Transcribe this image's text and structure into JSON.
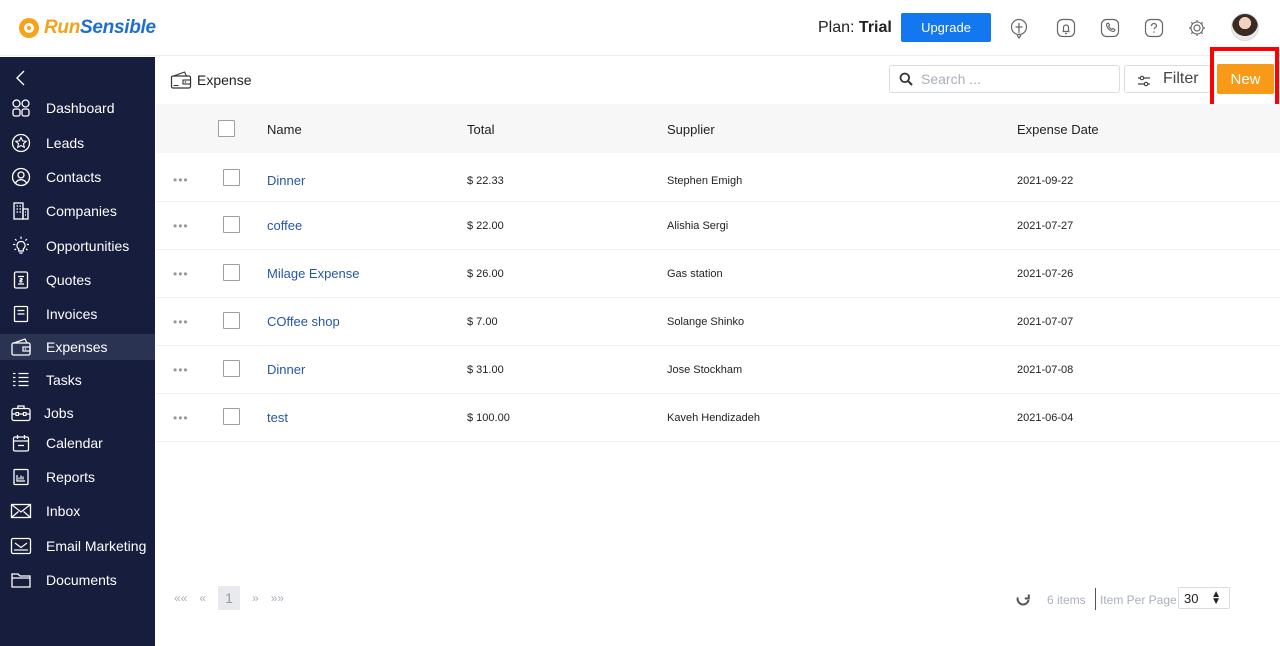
{
  "app": {
    "logo_part1": "Run",
    "logo_part2": "Sensible",
    "plan_label": "Plan:",
    "plan_value": "Trial",
    "upgrade_label": "Upgrade",
    "colors": {
      "accent_orange": "#f89a17",
      "primary_blue": "#1377ef",
      "sidebar_bg": "#161d3d",
      "link_blue": "#2656a6",
      "highlight_red": "#ff0000"
    }
  },
  "sidebar": {
    "items": [
      {
        "label": "Dashboard",
        "icon": "dashboard-icon"
      },
      {
        "label": "Leads",
        "icon": "star-badge-icon"
      },
      {
        "label": "Contacts",
        "icon": "contact-icon"
      },
      {
        "label": "Companies",
        "icon": "building-icon"
      },
      {
        "label": "Opportunities",
        "icon": "lightbulb-icon"
      },
      {
        "label": "Quotes",
        "icon": "quote-document-icon"
      },
      {
        "label": "Invoices",
        "icon": "invoice-icon"
      },
      {
        "label": "Expenses",
        "icon": "wallet-icon"
      },
      {
        "label": "Tasks",
        "icon": "task-list-icon"
      },
      {
        "label": "Jobs",
        "icon": "toolbox-icon"
      },
      {
        "label": "Calendar",
        "icon": "calendar-icon"
      },
      {
        "label": "Reports",
        "icon": "report-chart-icon"
      },
      {
        "label": "Inbox",
        "icon": "envelope-icon"
      },
      {
        "label": "Email Marketing",
        "icon": "email-marketing-icon"
      },
      {
        "label": "Documents",
        "icon": "folder-icon"
      }
    ],
    "active": "Expenses"
  },
  "page": {
    "title": "Expense",
    "search_placeholder": "Search ...",
    "filter_label": "Filter",
    "new_label": "New"
  },
  "table": {
    "columns": [
      "Name",
      "Total",
      "Supplier",
      "Expense Date"
    ],
    "rows": [
      {
        "name": "Dinner",
        "total": "$ 22.33",
        "supplier": "Stephen Emigh",
        "date": "2021-09-22"
      },
      {
        "name": "coffee",
        "total": "$ 22.00",
        "supplier": "Alishia Sergi",
        "date": "2021-07-27"
      },
      {
        "name": "Milage Expense",
        "total": "$ 26.00",
        "supplier": "Gas station",
        "date": "2021-07-26"
      },
      {
        "name": "COffee shop",
        "total": "$ 7.00",
        "supplier": "Solange Shinko",
        "date": "2021-07-07"
      },
      {
        "name": "Dinner",
        "total": "$ 31.00",
        "supplier": "Jose Stockham",
        "date": "2021-07-08"
      },
      {
        "name": "test",
        "total": "$ 100.00",
        "supplier": "Kaveh Hendizadeh",
        "date": "2021-06-04"
      }
    ]
  },
  "pagination": {
    "first": "««",
    "prev": "«",
    "current_page": "1",
    "next": "»",
    "last": "»»",
    "items_count": "6 items",
    "per_page_label": "Item Per Page",
    "per_page_value": "30"
  }
}
